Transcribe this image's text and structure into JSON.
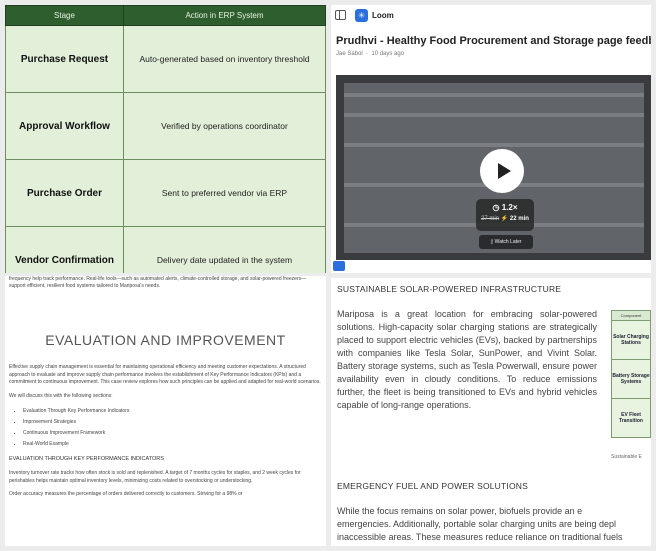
{
  "table_panel": {
    "headers": [
      "Stage",
      "Action in ERP System"
    ],
    "rows": [
      {
        "stage": "Purchase Request",
        "action": "Auto-generated based on inventory threshold"
      },
      {
        "stage": "Approval Workflow",
        "action": "Verified by operations coordinator"
      },
      {
        "stage": "Purchase Order",
        "action": "Sent to preferred vendor via ERP"
      },
      {
        "stage": "Vendor Confirmation",
        "action": "Delivery date updated in the system"
      }
    ]
  },
  "loom_panel": {
    "app_name": "Loom",
    "title": "Prudhvi - Healthy Food Procurement and Storage page feedb...",
    "author": "Jae Sabol",
    "age": "10 days ago",
    "speed": "1.2×",
    "original_time": "27 min",
    "new_time": "22 min",
    "watch_later": "Watch Later",
    "colors": {
      "accent": "#2a6fdc"
    }
  },
  "doc_panel": {
    "top_fragment": "frequency help track performance. Real-life tools—such as automated alerts, climate-controlled storage, and solar-powered freezers—support efficient, resilient food systems tailored to Mariposa's needs.",
    "heading": "EVALUATION AND IMPROVEMENT",
    "intro": "Effective supply chain management is essential for maintaining operational efficiency and meeting customer expectations. A structured approach to evaluate and improve supply chain performance involves the establishment of Key Performance Indicators (KPIs) and a commitment to continuous improvement. This case review explores how such principles can be applied and adapted for real-world scenarios.",
    "sections_lead": "We will discuss this with the following sections:",
    "sections": [
      "Evaluation Through Key Performance Indicators",
      "Improvement Strategies",
      "Continuous Improvement Framework",
      "Real-World Example"
    ],
    "subheading": "EVALUATION THROUGH KEY PERFORMANCE INDICATORS",
    "para1": "Inventory turnover rate tracks how often stock is sold and replenished. A target of 7 months cycles for staples, and 2 week cycles for perishables helps maintain optimal inventory levels, minimizing costs related to overstocking or understocking.",
    "para2": "Order accuracy measures the percentage of orders delivered correctly to customers. Striving for a 98% or"
  },
  "solar_panel": {
    "heading": "SUSTAINABLE SOLAR-POWERED INFRASTRUCTURE",
    "body": "Mariposa is a great location for embracing solar-powered solutions. High-capacity solar charging stations are strategically placed to support electric vehicles (EVs), backed by partnerships with companies like Tesla Solar, SunPower, and Vivint Solar. Battery storage systems, such as Tesla Powerwall, ensure power availability even in cloudy conditions. To reduce emissions further, the fleet is being transitioned to EVs and hybrid vehicles capable of long-range operations.",
    "table_header": "Component",
    "table_rows": [
      "Solar Charging Stations",
      "Battery Storage Systems",
      "EV Fleet Transition"
    ],
    "caption": "Sustainable E",
    "heading2": "EMERGENCY FUEL AND POWER SOLUTIONS",
    "body2_line1": "While the focus remains on solar power, biofuels provide an e",
    "body2_line2": "emergencies. Additionally, portable solar charging units are being depl",
    "body2_line3": "inaccessible areas. These measures reduce reliance on traditional fuels"
  }
}
